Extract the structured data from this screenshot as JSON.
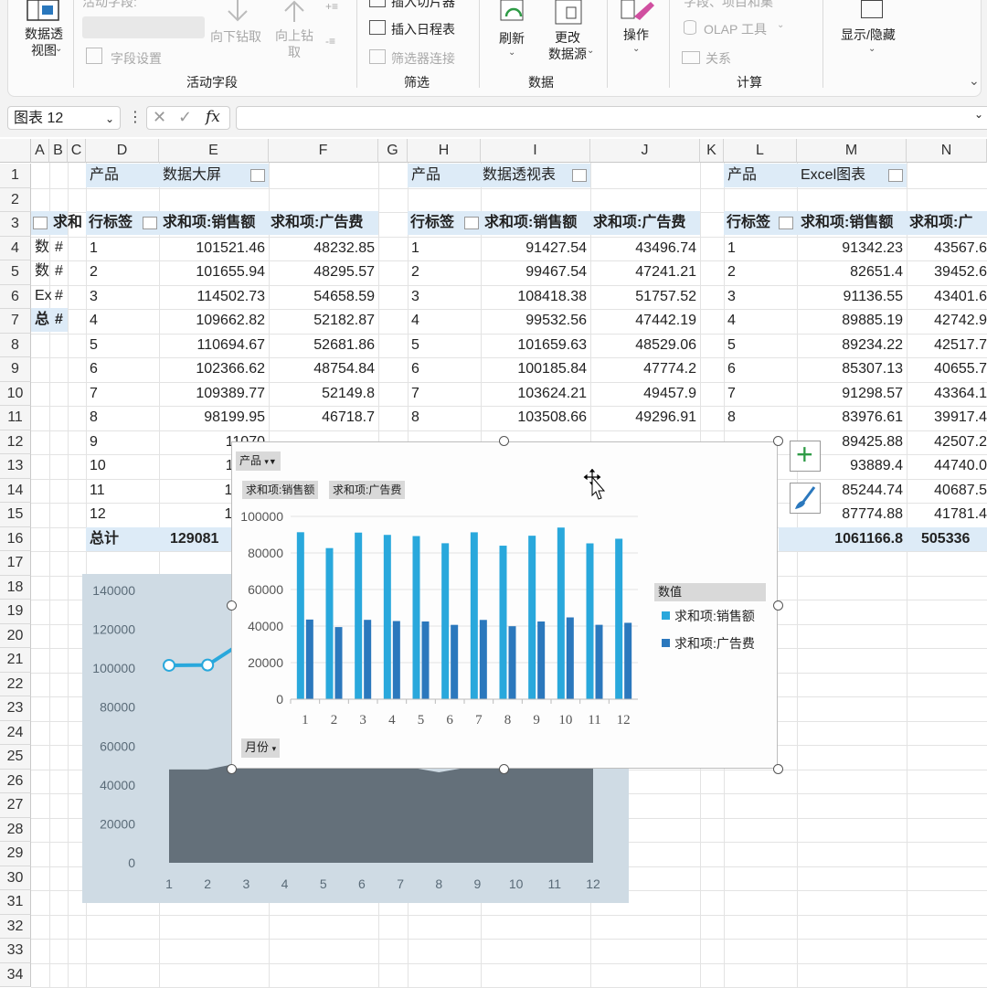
{
  "ribbon": {
    "active_field_label": "活动字段:",
    "pivot_chart_label": "数据透\n视图",
    "field_settings_label": "字段设置",
    "drill_down_label": "向下钻取",
    "drill_up_label": "向上钻\n取",
    "insert_slicer_label": "插入切片器",
    "insert_timeline_label": "插入日程表",
    "filter_connections_label": "筛选器连接",
    "refresh_label": "刷新",
    "change_source_label": "更改\n数据源",
    "actions_label": "操作",
    "fields_items_label": "字段、项目和集",
    "olap_tools_label": "OLAP 工具",
    "relationships_label": "关系",
    "show_hide_label": "显示/隐藏",
    "groups": [
      "活动字段",
      "筛选",
      "数据",
      "计算"
    ]
  },
  "formula_bar": {
    "name_box": "图表 12",
    "formula": ""
  },
  "columns": [
    "A",
    "B",
    "C",
    "D",
    "E",
    "F",
    "G",
    "H",
    "I",
    "J",
    "K",
    "L",
    "M",
    "N"
  ],
  "rows": [
    "1",
    "2",
    "3",
    "4",
    "5",
    "6",
    "7",
    "8",
    "9",
    "10",
    "11",
    "12",
    "13",
    "14",
    "15",
    "16",
    "17",
    "18",
    "19",
    "20",
    "21",
    "22",
    "23",
    "24",
    "25",
    "26",
    "27",
    "28",
    "29",
    "30",
    "31",
    "32",
    "33",
    "34"
  ],
  "left_table": {
    "rows": [
      [
        "求和",
        ""
      ],
      [
        "数",
        "#"
      ],
      [
        "数",
        "#"
      ],
      [
        "Ex",
        "#"
      ],
      [
        "总",
        "#"
      ]
    ]
  },
  "pivot_tables": [
    {
      "filter_field": "产品",
      "filter_value": "数据大屏",
      "row_label": "行标签",
      "col1": "求和项:销售额",
      "col2": "求和项:广告费",
      "labels": [
        "1",
        "2",
        "3",
        "4",
        "5",
        "6",
        "7",
        "8",
        "9",
        "10",
        "11",
        "12"
      ],
      "sales": [
        "101521.46",
        "101655.94",
        "114502.73",
        "109662.82",
        "110694.67",
        "102366.62",
        "109389.77",
        "98199.95",
        "11070",
        "11605",
        "10704",
        "10896"
      ],
      "ads": [
        "48232.85",
        "48295.57",
        "54658.59",
        "52182.87",
        "52681.86",
        "48754.84",
        "52149.8",
        "46718.7",
        "",
        "",
        "",
        ""
      ],
      "total_label": "总计",
      "total_sales": "129081",
      "total_ads": ""
    },
    {
      "filter_field": "产品",
      "filter_value": "数据透视表",
      "row_label": "行标签",
      "col1": "求和项:销售额",
      "col2": "求和项:广告费",
      "labels": [
        "1",
        "2",
        "3",
        "4",
        "5",
        "6",
        "7",
        "8"
      ],
      "sales": [
        "91427.54",
        "99467.54",
        "108418.38",
        "99532.56",
        "101659.63",
        "100185.84",
        "103624.21",
        "103508.66"
      ],
      "ads": [
        "43496.74",
        "47241.21",
        "51757.52",
        "47442.19",
        "48529.06",
        "47774.2",
        "49457.9",
        "49296.91"
      ]
    },
    {
      "filter_field": "产品",
      "filter_value": "Excel图表",
      "row_label": "行标签",
      "col1": "求和项:销售额",
      "col2": "求和项:广",
      "labels": [
        "1",
        "2",
        "3",
        "4",
        "5",
        "6",
        "7",
        "8"
      ],
      "sales": [
        "91342.23",
        "82651.4",
        "91136.55",
        "89885.19",
        "89234.22",
        "85307.13",
        "91298.57",
        "83976.61",
        "89425.88",
        "93889.4",
        "85244.74",
        "87774.88"
      ],
      "ads": [
        "43567.6",
        "39452.6",
        "43401.6",
        "42742.9",
        "42517.7",
        "40655.7",
        "43364.1",
        "39917.4",
        "42507.2",
        "44740.0",
        "40687.5",
        "41781.4"
      ],
      "total_sales": "1061166.8",
      "total_ads": "505336"
    }
  ],
  "chart_data": [
    {
      "type": "bar",
      "categories": [
        "1",
        "2",
        "3",
        "4",
        "5",
        "6",
        "7",
        "8",
        "9",
        "10",
        "11",
        "12"
      ],
      "series": [
        {
          "name": "求和项:销售额",
          "values": [
            91342,
            82651,
            91137,
            89885,
            89234,
            85307,
            91299,
            83977,
            89426,
            93889,
            85245,
            87775
          ]
        },
        {
          "name": "求和项:广告费",
          "values": [
            43568,
            39453,
            43402,
            42743,
            42518,
            40656,
            43364,
            39917,
            42507,
            44740,
            40688,
            41781
          ]
        }
      ],
      "ylim": [
        0,
        100000
      ],
      "yticks": [
        "100000",
        "80000",
        "60000",
        "40000",
        "20000",
        "0"
      ],
      "legend_title": "数值",
      "legend_position": "right",
      "filter_button": "产品",
      "axis_field_button": "月份",
      "colors": [
        "#29a8dc",
        "#2b78bd"
      ]
    },
    {
      "type": "area",
      "categories": [
        "1",
        "2",
        "3",
        "4",
        "5",
        "6",
        "7",
        "8",
        "9",
        "10",
        "11",
        "12"
      ],
      "area_values": [
        48000,
        48000,
        52000,
        52000,
        52000,
        51000,
        50000,
        46500,
        50000,
        52000,
        51000,
        50000
      ],
      "line_values": [
        101500,
        101650,
        114500
      ],
      "ylim": [
        0,
        140000
      ],
      "yticks": [
        "140000",
        "120000",
        "100000",
        "80000",
        "60000",
        "40000",
        "20000",
        "0"
      ],
      "colors": [
        "#64707a",
        "#29a8dc"
      ]
    }
  ],
  "side_buttons": {
    "add_element": "+",
    "style": "brush"
  }
}
